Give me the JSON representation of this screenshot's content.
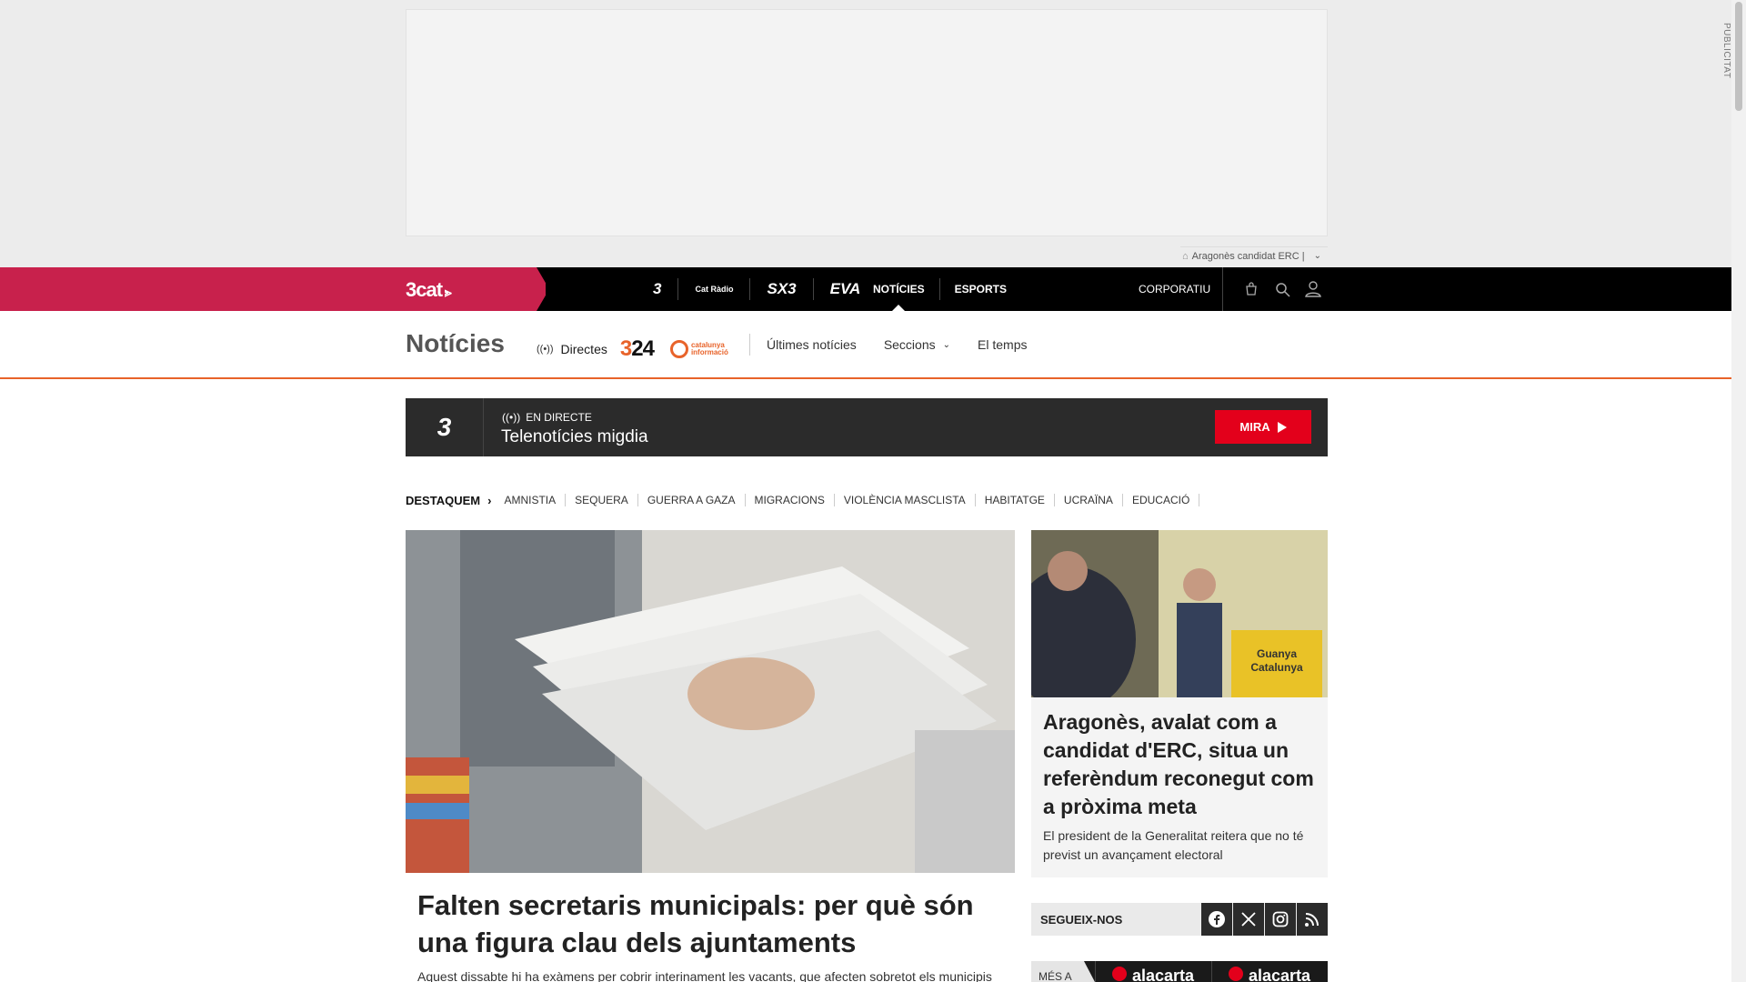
{
  "ad": {
    "publicitat": "PUBLICITAT",
    "tag_text": "Aragonès candidat ERC |"
  },
  "topnav": {
    "brand": "3cat",
    "channels": [
      "3",
      "Cat Ràdio",
      "SX3",
      "EVA"
    ],
    "links": [
      "NOTÍCIES",
      "ESPORTS"
    ],
    "corporate": "CORPORATIU"
  },
  "section": {
    "title": "Notícies",
    "directes": "Directes",
    "logo_324_a": "3",
    "logo_324_b": "24",
    "logo_ci_line1": "catalunya",
    "logo_ci_line2": "informació",
    "nav": [
      "Últimes notícies",
      "Seccions",
      "El temps"
    ]
  },
  "live": {
    "channel_logo": "3",
    "label": "EN DIRECTE",
    "title": "Telenotícies migdia",
    "button": "MIRA"
  },
  "destaquem": {
    "label": "DESTAQUEM",
    "items": [
      "AMNISTIA",
      "SEQUERA",
      "GUERRA A GAZA",
      "MIGRACIONS",
      "VIOLÈNCIA MASCLISTA",
      "HABITATGE",
      "UCRAÏNA",
      "EDUCACIÓ"
    ]
  },
  "main_article": {
    "title": "Falten secretaris municipals: per què són una figura clau dels ajuntaments",
    "subtitle": "Aquest dissabte hi ha exàmens per cobrir interinament les vacants, que afecten sobretot els municipis"
  },
  "side_article": {
    "image_sign_line1": "Guanya",
    "image_sign_line2": "Catalunya",
    "title": "Aragonès, avalat com a candidat d'ERC, situa un referèndum reconegut com a pròxima meta",
    "subtitle": "El president de la Generalitat reitera que no té previst un avançament electoral"
  },
  "social": {
    "label": "SEGUEIX-NOS",
    "icons": [
      "facebook-icon",
      "x-icon",
      "instagram-icon",
      "rss-icon"
    ]
  },
  "mesa": {
    "label": "MÉS A",
    "tabs": [
      "alacarta",
      "alacarta"
    ]
  },
  "colors": {
    "brand": "#c8214c",
    "accent_orange": "#e8632a",
    "live_red": "#e3001b",
    "nav_black": "#000000"
  }
}
